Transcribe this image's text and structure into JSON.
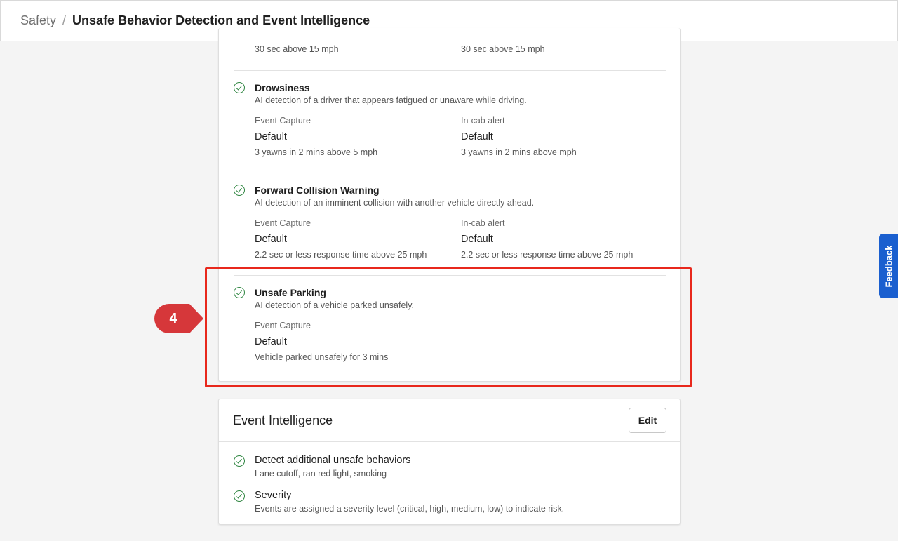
{
  "breadcrumb": {
    "parent": "Safety",
    "separator": "/",
    "current": "Unsafe Behavior Detection and Event Intelligence"
  },
  "partial_row": {
    "event_capture_sub": "30 sec above 15 mph",
    "in_cab_sub": "30 sec above 15 mph"
  },
  "behaviors": [
    {
      "title": "Drowsiness",
      "description": "AI detection of a driver that appears fatigued or unaware while driving.",
      "event_capture_label": "Event Capture",
      "event_capture_value": "Default",
      "event_capture_sub": "3 yawns in 2 mins above 5 mph",
      "in_cab_label": "In-cab alert",
      "in_cab_value": "Default",
      "in_cab_sub": "3 yawns in 2 mins above mph"
    },
    {
      "title": "Forward Collision Warning",
      "description": "AI detection of an imminent collision with another vehicle directly ahead.",
      "event_capture_label": "Event Capture",
      "event_capture_value": "Default",
      "event_capture_sub": "2.2 sec or less response time above 25 mph",
      "in_cab_label": "In-cab alert",
      "in_cab_value": "Default",
      "in_cab_sub": "2.2 sec or less response time above 25 mph"
    },
    {
      "title": "Unsafe Parking",
      "description": "AI detection of a vehicle parked unsafely.",
      "event_capture_label": "Event Capture",
      "event_capture_value": "Default",
      "event_capture_sub": "Vehicle parked unsafely for 3 mins"
    }
  ],
  "event_intelligence": {
    "title": "Event Intelligence",
    "edit_label": "Edit",
    "items": [
      {
        "title": "Detect additional unsafe behaviors",
        "description": "Lane cutoff, ran red light, smoking"
      },
      {
        "title": "Severity",
        "description": "Events are assigned a severity level (critical, high, medium, low) to indicate risk."
      }
    ]
  },
  "callout": {
    "step": "4",
    "color": "#d6373a",
    "highlight_color": "#e8281c"
  },
  "feedback": {
    "label": "Feedback",
    "color": "#1a5fcf"
  },
  "icons": {
    "check": "check-circle-icon"
  }
}
